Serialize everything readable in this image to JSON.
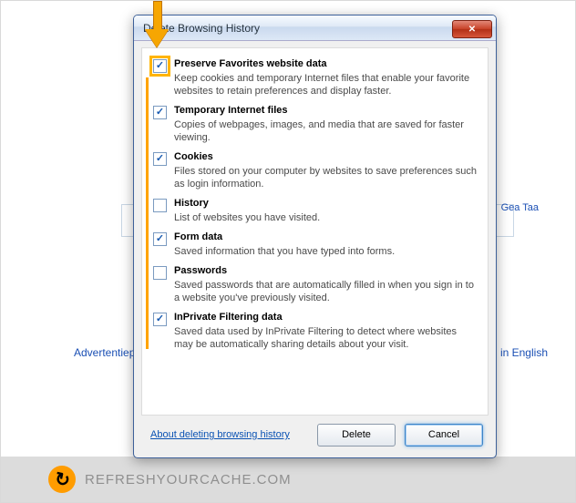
{
  "dialog": {
    "title": "Delete Browsing History",
    "close_icon": "✕",
    "help_link": "About deleting browsing history",
    "buttons": {
      "delete": "Delete",
      "cancel": "Cancel"
    },
    "items": [
      {
        "checked": true,
        "highlight": true,
        "label": "Preserve Favorites website data",
        "desc": "Keep cookies and temporary Internet files that enable your favorite websites to retain preferences and display faster."
      },
      {
        "checked": true,
        "highlight": false,
        "label": "Temporary Internet files",
        "desc": "Copies of webpages, images, and media that are saved for faster viewing."
      },
      {
        "checked": true,
        "highlight": false,
        "label": "Cookies",
        "desc": "Files stored on your computer by websites to save preferences such as login information."
      },
      {
        "checked": false,
        "highlight": false,
        "label": "History",
        "desc": "List of websites you have visited."
      },
      {
        "checked": true,
        "highlight": false,
        "label": "Form data",
        "desc": "Saved information that you have typed into forms."
      },
      {
        "checked": false,
        "highlight": false,
        "label": "Passwords",
        "desc": "Saved passwords that are automatically filled in when you sign in to a website you've previously visited."
      },
      {
        "checked": true,
        "highlight": false,
        "label": "InPrivate Filtering data",
        "desc": "Saved data used by InPrivate Filtering to detect where websites may be automatically sharing details about your visit."
      }
    ]
  },
  "background": {
    "right_links": "Gea\nTaa",
    "left_link": "Advertentiepr",
    "right_link2": "om in English"
  },
  "footer": {
    "brand": "REFRESHYOURCACHE.COM"
  }
}
